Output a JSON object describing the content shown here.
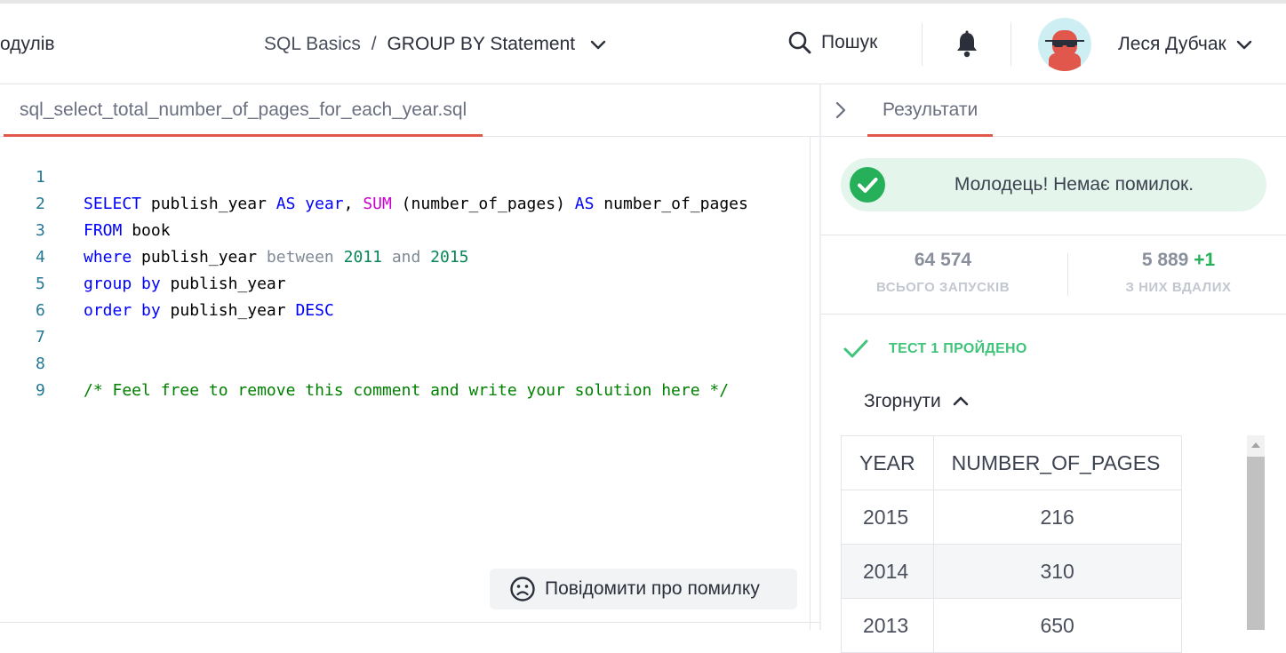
{
  "header": {
    "modules_label": "одулів",
    "course": "SQL Basics",
    "separator": " / ",
    "lesson": "GROUP BY Statement",
    "search_label": "Пошук",
    "user_name": "Леся Дубчак"
  },
  "editor": {
    "file_name": "sql_select_total_number_of_pages_for_each_year.sql",
    "line_numbers": [
      "1",
      "2",
      "3",
      "4",
      "5",
      "6",
      "7",
      "8",
      "9"
    ],
    "tokens": {
      "l1": [
        "SELECT",
        " publish_year ",
        "AS",
        " ",
        "year",
        ", ",
        "SUM",
        " (number_of_pages) ",
        "AS",
        " number_of_pages"
      ],
      "l2": [
        "FROM",
        " book"
      ],
      "l3": [
        "where",
        " publish_year ",
        "between",
        " ",
        "2011",
        " ",
        "and",
        " ",
        "2015"
      ],
      "l4": [
        "group",
        " ",
        "by",
        " publish_year"
      ],
      "l5": [
        "order",
        " ",
        "by",
        " publish_year ",
        "DESC"
      ],
      "l8": [
        "/* Feel free to remove this comment and write your solution here */"
      ]
    },
    "report_button": "Повідомити про помилку"
  },
  "results": {
    "tab_label": "Результати",
    "success_message": "Молодець! Немає помилок.",
    "stats": {
      "total_runs_value": "64 574",
      "total_runs_label": "ВСЬОГО ЗАПУСКІВ",
      "successful_value": "5 889",
      "successful_delta": "+1",
      "successful_label": "З НИХ ВДАЛИХ"
    },
    "test_status": "ТЕСТ 1 ПРОЙДЕНО",
    "collapse_label": "Згорнути",
    "table": {
      "columns": [
        "YEAR",
        "NUMBER_OF_PAGES"
      ],
      "rows": [
        [
          "2015",
          "216"
        ],
        [
          "2014",
          "310"
        ],
        [
          "2013",
          "650"
        ]
      ]
    }
  },
  "colors": {
    "accent_tab_underline": "#e2574c",
    "success_green": "#27b05a",
    "success_bg": "#e4f6ec"
  }
}
